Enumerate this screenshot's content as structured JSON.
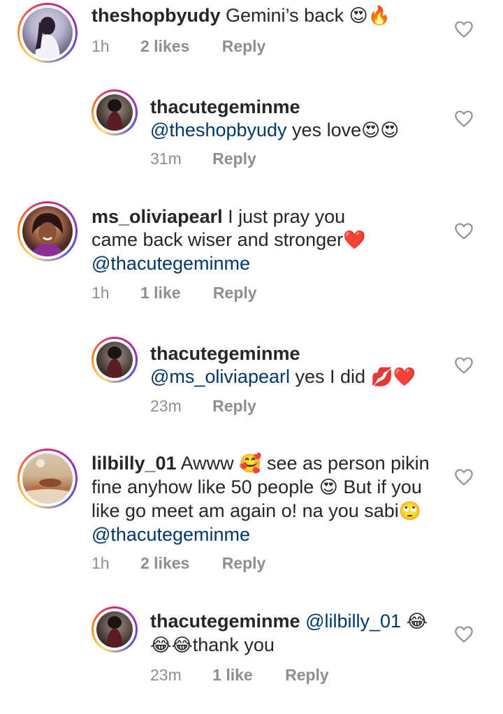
{
  "comments": [
    {
      "username": "theshopbyudy",
      "text": "Gemini’s back",
      "emoji": "😍🔥",
      "time": "1h",
      "likes": "2 likes",
      "reply": "Reply"
    },
    {
      "username": "thacutegeminme",
      "mention": "@theshopbyudy",
      "text": " yes love",
      "emoji": "😍😍",
      "time": "31m",
      "reply": "Reply"
    },
    {
      "username": "ms_oliviapearl",
      "text_line1": "I just pray you",
      "text_line2": "came back wiser and stronger",
      "emoji": "❤️",
      "mention": "@thacutegeminme",
      "time": "1h",
      "likes": "1 like",
      "reply": "Reply"
    },
    {
      "username": "thacutegeminme",
      "mention": "@ms_oliviapearl",
      "text": " yes I did ",
      "emoji": "💋❤️",
      "time": "23m",
      "reply": "Reply"
    },
    {
      "username": "lilbilly_01",
      "text_a": "Awww ",
      "emoji_a": "🥰",
      "text_b": " see as person pikin",
      "text_c": "fine anyhow like 50 people ",
      "emoji_b": "😍",
      "text_d": " But if you",
      "text_e": "like go meet am again o! na you sabi",
      "emoji_c": "🙄",
      "mention": "@thacutegeminme",
      "time": "1h",
      "likes": "2 likes",
      "reply": "Reply"
    },
    {
      "username": "thacutegeminme",
      "mention": "@lilbilly_01",
      "emoji_a": "😂",
      "emoji_b": "😂😂",
      "text": "thank you",
      "time": "23m",
      "likes": "1 like",
      "reply": "Reply"
    }
  ],
  "icons": {
    "like": "heart-outline-icon"
  },
  "colors": {
    "mention": "#00376b",
    "meta": "#8e8e8e",
    "heart_stroke": "#8e8e8e"
  }
}
